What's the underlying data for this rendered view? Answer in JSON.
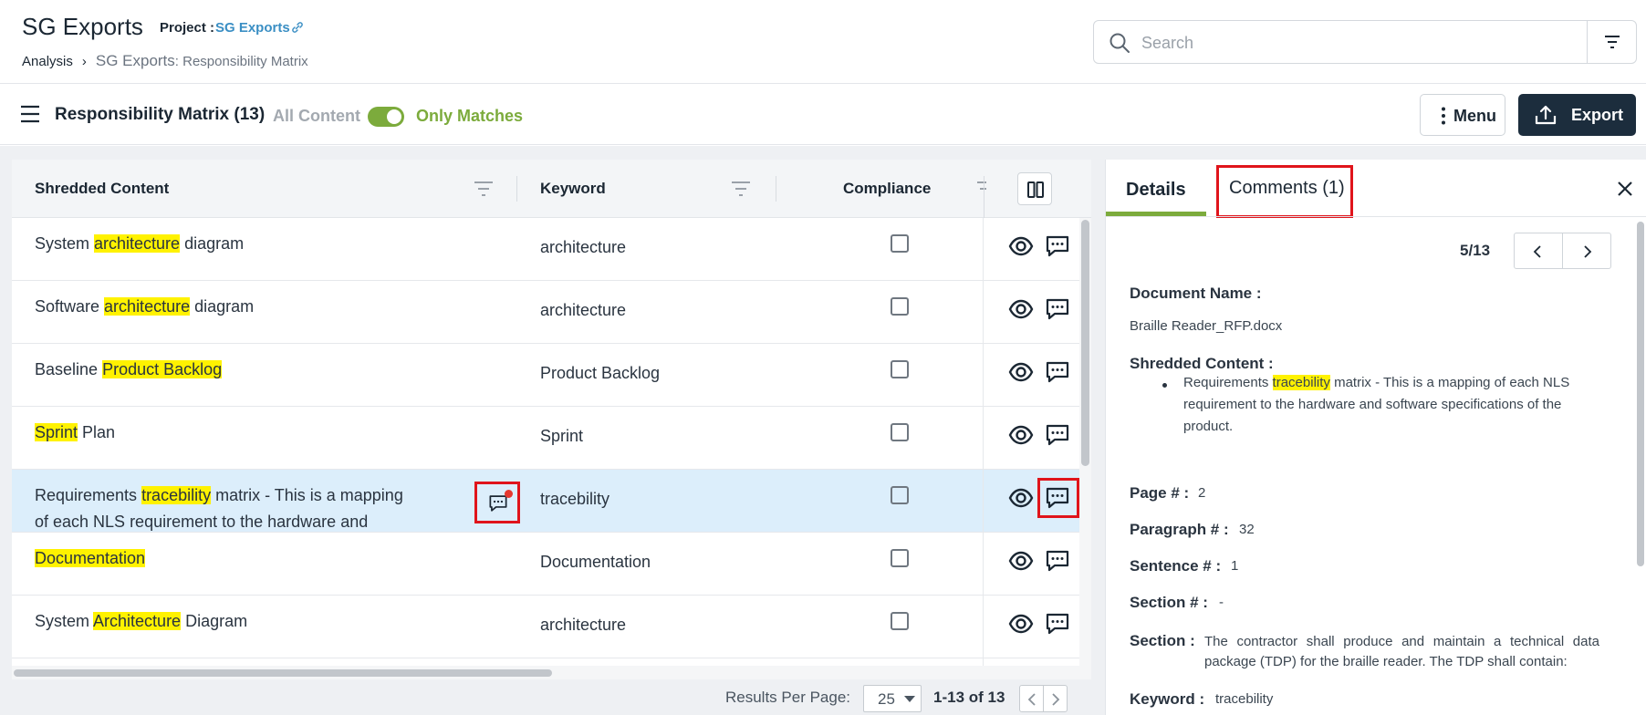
{
  "header": {
    "app_title": "SG Exports",
    "project_label": "Project :",
    "project_name": "SG Exports",
    "breadcrumb": {
      "root": "Analysis",
      "sep": "›",
      "mid": "SG Exports",
      "last": ": Responsibility Matrix"
    }
  },
  "search": {
    "placeholder": "Search",
    "value": ""
  },
  "toolbar": {
    "title": "Responsibility Matrix (13)",
    "toggle_off_label": "All Content",
    "toggle_on_label": "Only Matches",
    "toggle_state": "on",
    "menu_label": "Menu",
    "export_label": "Export"
  },
  "table": {
    "columns": [
      "Shredded Content",
      "Keyword",
      "Compliance"
    ],
    "rows": [
      {
        "pre": "System ",
        "hl": "architecture",
        "post": " diagram",
        "keyword": "architecture"
      },
      {
        "pre": "Software ",
        "hl": "architecture",
        "post": " diagram",
        "keyword": "architecture"
      },
      {
        "pre": "Baseline ",
        "hl": "Product Backlog",
        "post": "",
        "keyword": "Product Backlog"
      },
      {
        "pre": "",
        "hl": "Sprint",
        "post": " Plan",
        "keyword": "Sprint"
      },
      {
        "pre": "Requirements ",
        "hl": "tracebility",
        "post": " matrix - This is a mapping of each NLS requirement to the hardware and softwar…",
        "keyword": "tracebility"
      },
      {
        "pre": "",
        "hl": "Documentation",
        "post": "",
        "keyword": "Documentation"
      },
      {
        "pre": "System ",
        "hl": "Architecture",
        "post": " Diagram",
        "keyword": "architecture"
      }
    ],
    "selected_row": 4
  },
  "pagination": {
    "label": "Results Per Page:",
    "per_page": "25",
    "range": "1-13 of 13"
  },
  "details": {
    "tab_details": "Details",
    "tab_comments": "Comments (1)",
    "counter": "5/13",
    "document_name_label": "Document Name :",
    "document_name": "Braille Reader_RFP.docx",
    "shredded_label": "Shredded Content :",
    "shredded_pre": "Requirements ",
    "shredded_hl": "tracebility",
    "shredded_post": " matrix - This is a mapping of each NLS requirement to the hardware and software specifications of the product.",
    "page_label": "Page # :",
    "page": "2",
    "paragraph_label": "Paragraph # :",
    "paragraph": "32",
    "sentence_label": "Sentence # :",
    "sentence": "1",
    "section_no_label": "Section # :",
    "section_no": "-",
    "section_label": "Section :",
    "section": "The contractor shall produce and maintain a technical data package (TDP) for the braille reader. The TDP shall contain:",
    "keyword_label": "Keyword :",
    "keyword": "tracebility"
  },
  "colors": {
    "accent_green": "#7cab3c",
    "export_bg": "#1c2d3d",
    "highlight": "#fff200",
    "selected_row": "#dceefb",
    "annotation_red": "#e0141b",
    "link_blue": "#3b8fc4"
  },
  "icons": [
    "link-icon",
    "search-icon",
    "filter-icon",
    "hamburger-icon",
    "kebab-icon",
    "export-icon",
    "column-filter-icon",
    "columns-icon",
    "eye-icon",
    "comment-icon",
    "chevron-left-icon",
    "chevron-right-icon",
    "close-icon"
  ]
}
